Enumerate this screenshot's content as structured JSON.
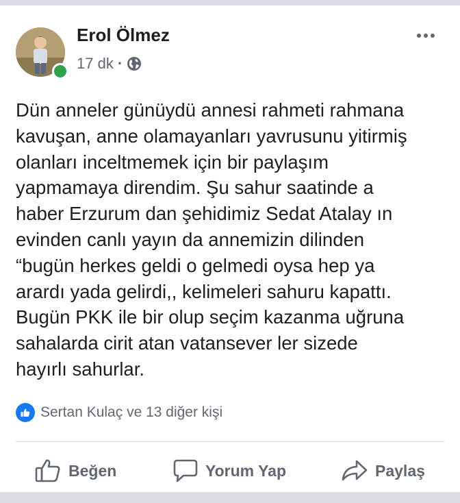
{
  "post": {
    "author": "Erol Ölmez",
    "time": "17 dk",
    "separator": "·",
    "privacy_icon": "globe-icon",
    "text": "Dün anneler günüydü annesi rahmeti rahmana\nkavuşan, anne olamayanları yavrusunu yitirmiş\nolanları inceltmemek için bir paylaşım\nyapmamaya direndim. Şu sahur saatinde a\nhaber Erzurum dan şehidimiz Sedat Atalay ın\nevinden canlı yayın da annemizin dilinden\n“bugün herkes geldi o gelmedi oysa hep ya\narardı yada gelirdi,, kelimeleri sahuru kapattı.\nBugün PKK ile bir olup seçim kazanma uğruna\nsahalarda cirit atan vatansever ler sizede\nhayırlı  sahurlar.",
    "reactions": "Sertan Kulaç ve 13 diğer kişi",
    "online_status_color": "#31a24c",
    "like_color": "#1877f2"
  },
  "actions": {
    "like": "Beğen",
    "comment": "Yorum Yap",
    "share": "Paylaş"
  }
}
